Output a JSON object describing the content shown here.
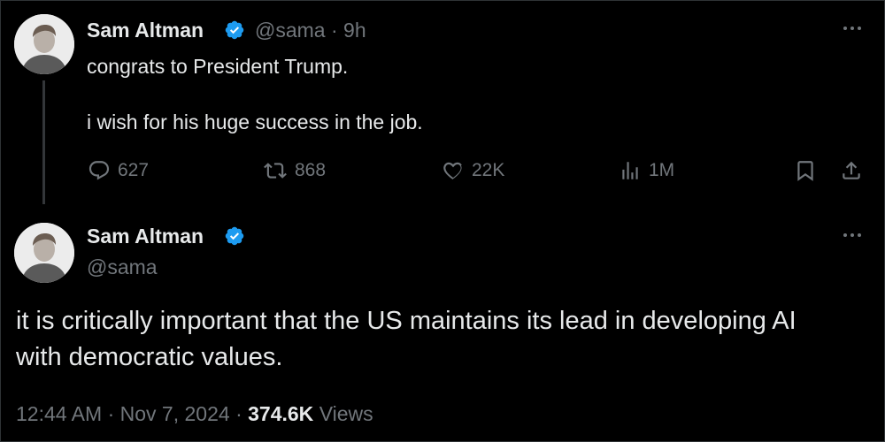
{
  "tweet1": {
    "author_name": "Sam Altman",
    "handle": "@sama",
    "separator": "·",
    "age": "9h",
    "lines": [
      "congrats to President Trump.",
      "i wish for his huge success in the job."
    ],
    "stats": {
      "replies": "627",
      "reposts": "868",
      "likes": "22K",
      "views": "1M"
    },
    "icons": [
      "reply-icon",
      "repost-icon",
      "like-icon",
      "views-icon",
      "bookmark-icon",
      "share-icon",
      "more-icon"
    ]
  },
  "tweet2": {
    "author_name": "Sam Altman",
    "handle": "@sama",
    "lines": [
      "it is critically important that the US maintains its lead in developing AI",
      "with democratic values."
    ],
    "time": "12:44 AM",
    "separator": "·",
    "date": "Nov 7, 2024",
    "views_count": "374.6K",
    "views_label": "Views"
  },
  "colors": {
    "background": "#000000",
    "text": "#e7e9ea",
    "muted": "#71767b",
    "verified": "#1d9bf0"
  }
}
